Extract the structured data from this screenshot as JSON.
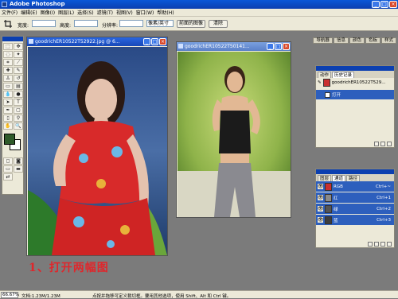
{
  "app": {
    "title": "Adobe Photoshop"
  },
  "menu": [
    "文件(F)",
    "编辑(E)",
    "图像(I)",
    "图层(L)",
    "选择(S)",
    "滤镜(T)",
    "视图(V)",
    "窗口(W)",
    "帮助(H)"
  ],
  "options": {
    "width_label": "宽度:",
    "height_label": "高度:",
    "resolution_label": "分辨率:",
    "unit_value": "像素/英寸",
    "front_image_button": "前面的图像",
    "clear_button": "清除"
  },
  "palette_wells": [
    "导航器",
    "信息",
    "颜色",
    "色板",
    "样式"
  ],
  "doc1": {
    "title": "goodrichER10522T52922.jpg @ 6..."
  },
  "doc2": {
    "title": "goodrichER10522T50141..."
  },
  "annotation": "1、打开两幅图",
  "history_panel": {
    "tabs": [
      "动作",
      "历史记录"
    ],
    "snapshot": "goodrichER10522T529...",
    "step": "打开"
  },
  "channels_panel": {
    "tabs": [
      "图层",
      "通道",
      "路径"
    ],
    "rows": [
      {
        "name": "RGB",
        "shortcut": "Ctrl+~"
      },
      {
        "name": "红",
        "shortcut": "Ctrl+1"
      },
      {
        "name": "绿",
        "shortcut": "Ctrl+2"
      },
      {
        "name": "蓝",
        "shortcut": "Ctrl+3"
      }
    ]
  },
  "status": {
    "zoom": "66.67%",
    "doc_size": "文档:1.23M/1.23M",
    "hint": "点按并拖移可定义裁切框。要用其他选项，使用 Shift、Alt 和 Ctrl 键。"
  },
  "colors": {
    "titlebar": "#0b3fb0",
    "selection": "#2d5fbd",
    "annotation": "#e0262b"
  }
}
